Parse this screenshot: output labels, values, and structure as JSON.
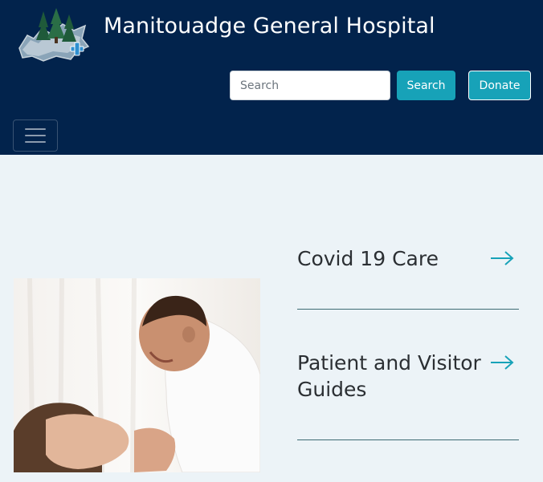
{
  "header": {
    "site_title": "Manitouadge General Hospital",
    "search": {
      "placeholder": "Search",
      "value": ""
    },
    "search_button_label": "Search",
    "donate_button_label": "Donate",
    "menu_icon": "hamburger-menu-icon"
  },
  "main": {
    "links": [
      {
        "label": "Covid 19 Care",
        "icon": "arrow-right-icon"
      },
      {
        "label": "Patient and Visitor Guides",
        "icon": "arrow-right-icon"
      }
    ]
  },
  "colors": {
    "header_bg": "#02234c",
    "page_bg": "#ecf3f7",
    "accent": "#17a2b8",
    "title_text": "#2b2f33",
    "divider": "#3d6a73"
  }
}
